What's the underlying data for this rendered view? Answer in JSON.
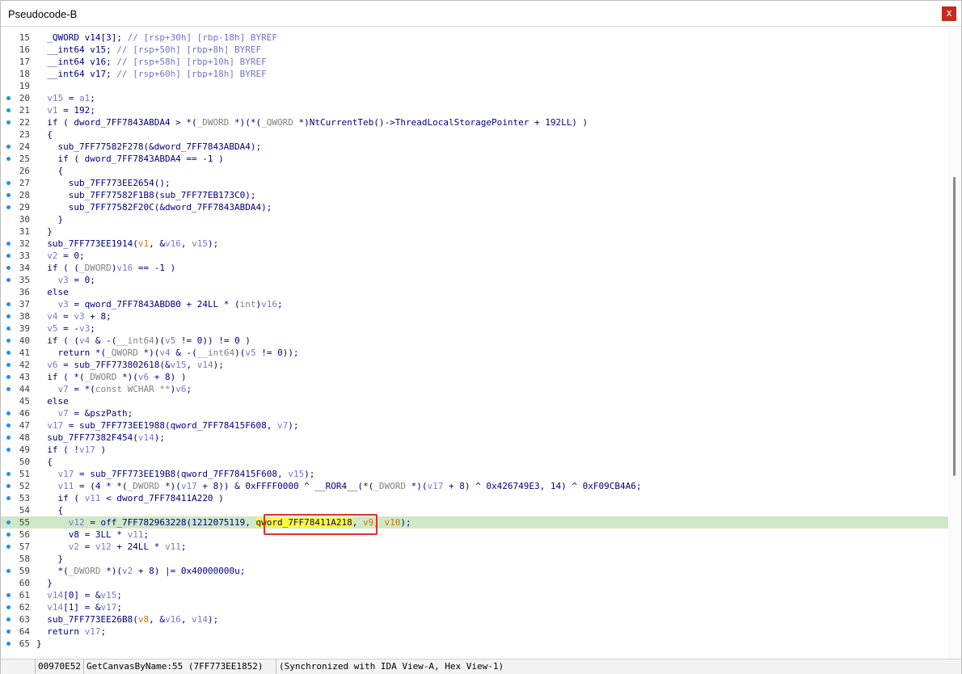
{
  "window": {
    "title": "Pseudocode-B",
    "close_label": "x"
  },
  "code": [
    {
      "n": "15",
      "dot": false,
      "hl": false,
      "tokens": [
        {
          "t": "  _QWORD v14[3]; ",
          "c": "kw"
        },
        {
          "t": "// [rsp+30h] [rbp-18h] BYREF",
          "c": "cm"
        }
      ]
    },
    {
      "n": "16",
      "dot": false,
      "hl": false,
      "tokens": [
        {
          "t": "  __int64 v15; ",
          "c": "kw"
        },
        {
          "t": "// [rsp+50h] [rbp+8h] BYREF",
          "c": "cm"
        }
      ]
    },
    {
      "n": "17",
      "dot": false,
      "hl": false,
      "tokens": [
        {
          "t": "  __int64 v16; ",
          "c": "kw"
        },
        {
          "t": "// [rsp+58h] [rbp+10h] BYREF",
          "c": "cm"
        }
      ]
    },
    {
      "n": "18",
      "dot": false,
      "hl": false,
      "tokens": [
        {
          "t": "  __int64 v17; ",
          "c": "kw"
        },
        {
          "t": "// [rsp+60h] [rbp+18h] BYREF",
          "c": "cm"
        }
      ]
    },
    {
      "n": "19",
      "dot": false,
      "hl": false,
      "tokens": []
    },
    {
      "n": "20",
      "dot": true,
      "hl": false,
      "tokens": [
        {
          "t": "  ",
          "c": "kw"
        },
        {
          "t": "v15",
          "c": "var"
        },
        {
          "t": " = ",
          "c": "kw"
        },
        {
          "t": "a1",
          "c": "var"
        },
        {
          "t": ";",
          "c": "kw"
        }
      ]
    },
    {
      "n": "21",
      "dot": true,
      "hl": false,
      "tokens": [
        {
          "t": "  ",
          "c": "kw"
        },
        {
          "t": "v1",
          "c": "var"
        },
        {
          "t": " = 192;",
          "c": "kw"
        }
      ]
    },
    {
      "n": "22",
      "dot": true,
      "hl": false,
      "tokens": [
        {
          "t": "  if ( dword_7FF7843ABDA4 > *(",
          "c": "kw"
        },
        {
          "t": "_DWORD",
          "c": "ty"
        },
        {
          "t": " *)(*(",
          "c": "kw"
        },
        {
          "t": "_QWORD",
          "c": "ty"
        },
        {
          "t": " *)NtCurrentTeb()->ThreadLocalStoragePointer + 192LL) )",
          "c": "kw"
        }
      ]
    },
    {
      "n": "23",
      "dot": false,
      "hl": false,
      "tokens": [
        {
          "t": "  {",
          "c": "kw"
        }
      ]
    },
    {
      "n": "24",
      "dot": true,
      "hl": false,
      "tokens": [
        {
          "t": "    sub_7FF77582F278(&dword_7FF7843ABDA4);",
          "c": "kw"
        }
      ]
    },
    {
      "n": "25",
      "dot": true,
      "hl": false,
      "tokens": [
        {
          "t": "    if ( dword_7FF7843ABDA4 == -1 )",
          "c": "kw"
        }
      ]
    },
    {
      "n": "26",
      "dot": false,
      "hl": false,
      "tokens": [
        {
          "t": "    {",
          "c": "kw"
        }
      ]
    },
    {
      "n": "27",
      "dot": true,
      "hl": false,
      "tokens": [
        {
          "t": "      sub_7FF773EE2654();",
          "c": "kw"
        }
      ]
    },
    {
      "n": "28",
      "dot": true,
      "hl": false,
      "tokens": [
        {
          "t": "      sub_7FF77582F1B8(sub_7FF77EB173C0);",
          "c": "kw"
        }
      ]
    },
    {
      "n": "29",
      "dot": true,
      "hl": false,
      "tokens": [
        {
          "t": "      sub_7FF77582F20C(&dword_7FF7843ABDA4);",
          "c": "kw"
        }
      ]
    },
    {
      "n": "30",
      "dot": false,
      "hl": false,
      "tokens": [
        {
          "t": "    }",
          "c": "kw"
        }
      ]
    },
    {
      "n": "31",
      "dot": false,
      "hl": false,
      "tokens": [
        {
          "t": "  }",
          "c": "kw"
        }
      ]
    },
    {
      "n": "32",
      "dot": true,
      "hl": false,
      "tokens": [
        {
          "t": "  sub_7FF773EE1914(",
          "c": "kw"
        },
        {
          "t": "v1",
          "c": "arg"
        },
        {
          "t": ", &",
          "c": "kw"
        },
        {
          "t": "v16",
          "c": "var"
        },
        {
          "t": ", ",
          "c": "kw"
        },
        {
          "t": "v15",
          "c": "var"
        },
        {
          "t": ");",
          "c": "kw"
        }
      ]
    },
    {
      "n": "33",
      "dot": true,
      "hl": false,
      "tokens": [
        {
          "t": "  ",
          "c": "kw"
        },
        {
          "t": "v2",
          "c": "var"
        },
        {
          "t": " = 0;",
          "c": "kw"
        }
      ]
    },
    {
      "n": "34",
      "dot": true,
      "hl": false,
      "tokens": [
        {
          "t": "  if ( (",
          "c": "kw"
        },
        {
          "t": "_DWORD",
          "c": "ty"
        },
        {
          "t": ")",
          "c": "kw"
        },
        {
          "t": "v16",
          "c": "var"
        },
        {
          "t": " == -1 )",
          "c": "kw"
        }
      ]
    },
    {
      "n": "35",
      "dot": true,
      "hl": false,
      "tokens": [
        {
          "t": "    ",
          "c": "kw"
        },
        {
          "t": "v3",
          "c": "var"
        },
        {
          "t": " = 0;",
          "c": "kw"
        }
      ]
    },
    {
      "n": "36",
      "dot": false,
      "hl": false,
      "tokens": [
        {
          "t": "  else",
          "c": "kw"
        }
      ]
    },
    {
      "n": "37",
      "dot": true,
      "hl": false,
      "tokens": [
        {
          "t": "    ",
          "c": "kw"
        },
        {
          "t": "v3",
          "c": "var"
        },
        {
          "t": " = qword_7FF7843ABDB0 + 24LL * (",
          "c": "kw"
        },
        {
          "t": "int",
          "c": "ty"
        },
        {
          "t": ")",
          "c": "kw"
        },
        {
          "t": "v16",
          "c": "var"
        },
        {
          "t": ";",
          "c": "kw"
        }
      ]
    },
    {
      "n": "38",
      "dot": true,
      "hl": false,
      "tokens": [
        {
          "t": "  ",
          "c": "kw"
        },
        {
          "t": "v4",
          "c": "var"
        },
        {
          "t": " = ",
          "c": "kw"
        },
        {
          "t": "v3",
          "c": "var"
        },
        {
          "t": " + 8;",
          "c": "kw"
        }
      ]
    },
    {
      "n": "39",
      "dot": true,
      "hl": false,
      "tokens": [
        {
          "t": "  ",
          "c": "kw"
        },
        {
          "t": "v5",
          "c": "var"
        },
        {
          "t": " = -",
          "c": "kw"
        },
        {
          "t": "v3",
          "c": "var"
        },
        {
          "t": ";",
          "c": "kw"
        }
      ]
    },
    {
      "n": "40",
      "dot": true,
      "hl": false,
      "tokens": [
        {
          "t": "  if ( (",
          "c": "kw"
        },
        {
          "t": "v4",
          "c": "var"
        },
        {
          "t": " & -(",
          "c": "kw"
        },
        {
          "t": "__int64",
          "c": "ty"
        },
        {
          "t": ")(",
          "c": "kw"
        },
        {
          "t": "v5",
          "c": "var"
        },
        {
          "t": " != 0)) != 0 )",
          "c": "kw"
        }
      ]
    },
    {
      "n": "41",
      "dot": true,
      "hl": false,
      "tokens": [
        {
          "t": "    return *(",
          "c": "kw"
        },
        {
          "t": "_QWORD",
          "c": "ty"
        },
        {
          "t": " *)(",
          "c": "kw"
        },
        {
          "t": "v4",
          "c": "var"
        },
        {
          "t": " & -(",
          "c": "kw"
        },
        {
          "t": "__int64",
          "c": "ty"
        },
        {
          "t": ")(",
          "c": "kw"
        },
        {
          "t": "v5",
          "c": "var"
        },
        {
          "t": " != 0));",
          "c": "kw"
        }
      ]
    },
    {
      "n": "42",
      "dot": true,
      "hl": false,
      "tokens": [
        {
          "t": "  ",
          "c": "kw"
        },
        {
          "t": "v6",
          "c": "var"
        },
        {
          "t": " = sub_7FF773802618(&",
          "c": "kw"
        },
        {
          "t": "v15",
          "c": "var"
        },
        {
          "t": ", ",
          "c": "kw"
        },
        {
          "t": "v14",
          "c": "var"
        },
        {
          "t": ");",
          "c": "kw"
        }
      ]
    },
    {
      "n": "43",
      "dot": true,
      "hl": false,
      "tokens": [
        {
          "t": "  if ( *(",
          "c": "kw"
        },
        {
          "t": "_DWORD",
          "c": "ty"
        },
        {
          "t": " *)(",
          "c": "kw"
        },
        {
          "t": "v6",
          "c": "var"
        },
        {
          "t": " + 8) )",
          "c": "kw"
        }
      ]
    },
    {
      "n": "44",
      "dot": true,
      "hl": false,
      "tokens": [
        {
          "t": "    ",
          "c": "kw"
        },
        {
          "t": "v7",
          "c": "var"
        },
        {
          "t": " = *(",
          "c": "kw"
        },
        {
          "t": "const WCHAR **",
          "c": "ty"
        },
        {
          "t": ")",
          "c": "kw"
        },
        {
          "t": "v6",
          "c": "var"
        },
        {
          "t": ";",
          "c": "kw"
        }
      ]
    },
    {
      "n": "45",
      "dot": false,
      "hl": false,
      "tokens": [
        {
          "t": "  else",
          "c": "kw"
        }
      ]
    },
    {
      "n": "46",
      "dot": true,
      "hl": false,
      "tokens": [
        {
          "t": "    ",
          "c": "kw"
        },
        {
          "t": "v7",
          "c": "var"
        },
        {
          "t": " = &pszPath;",
          "c": "kw"
        }
      ]
    },
    {
      "n": "47",
      "dot": true,
      "hl": false,
      "tokens": [
        {
          "t": "  ",
          "c": "kw"
        },
        {
          "t": "v17",
          "c": "var"
        },
        {
          "t": " = sub_7FF773EE1988(qword_7FF78415F608, ",
          "c": "kw"
        },
        {
          "t": "v7",
          "c": "var"
        },
        {
          "t": ");",
          "c": "kw"
        }
      ]
    },
    {
      "n": "48",
      "dot": true,
      "hl": false,
      "tokens": [
        {
          "t": "  sub_7FF77382F454(",
          "c": "kw"
        },
        {
          "t": "v14",
          "c": "var"
        },
        {
          "t": ");",
          "c": "kw"
        }
      ]
    },
    {
      "n": "49",
      "dot": true,
      "hl": false,
      "tokens": [
        {
          "t": "  if ( !",
          "c": "kw"
        },
        {
          "t": "v17",
          "c": "var"
        },
        {
          "t": " )",
          "c": "kw"
        }
      ]
    },
    {
      "n": "50",
      "dot": false,
      "hl": false,
      "tokens": [
        {
          "t": "  {",
          "c": "kw"
        }
      ]
    },
    {
      "n": "51",
      "dot": true,
      "hl": false,
      "tokens": [
        {
          "t": "    ",
          "c": "kw"
        },
        {
          "t": "v17",
          "c": "var"
        },
        {
          "t": " = sub_7FF773EE19B8(qword_7FF78415F608, ",
          "c": "kw"
        },
        {
          "t": "v15",
          "c": "var"
        },
        {
          "t": ");",
          "c": "kw"
        }
      ]
    },
    {
      "n": "52",
      "dot": true,
      "hl": false,
      "tokens": [
        {
          "t": "    ",
          "c": "kw"
        },
        {
          "t": "v11",
          "c": "var"
        },
        {
          "t": " = (4 * *(",
          "c": "kw"
        },
        {
          "t": "_DWORD",
          "c": "ty"
        },
        {
          "t": " *)(",
          "c": "kw"
        },
        {
          "t": "v17",
          "c": "var"
        },
        {
          "t": " + 8)) & 0xFFFF0000 ^ __ROR4__(*(",
          "c": "kw"
        },
        {
          "t": "_DWORD",
          "c": "ty"
        },
        {
          "t": " *)(",
          "c": "kw"
        },
        {
          "t": "v17",
          "c": "var"
        },
        {
          "t": " + 8) ^ 0x426749E3, 14) ^ 0xF09CB4A6;",
          "c": "kw"
        }
      ]
    },
    {
      "n": "53",
      "dot": true,
      "hl": false,
      "tokens": [
        {
          "t": "    if ( ",
          "c": "kw"
        },
        {
          "t": "v11",
          "c": "var"
        },
        {
          "t": " < dword_7FF78411A220 )",
          "c": "kw"
        }
      ]
    },
    {
      "n": "54",
      "dot": false,
      "hl": false,
      "tokens": [
        {
          "t": "    {",
          "c": "kw"
        }
      ]
    },
    {
      "n": "55",
      "dot": true,
      "hl": true,
      "tokens": [
        {
          "t": "      ",
          "c": "kw"
        },
        {
          "t": "v12",
          "c": "var"
        },
        {
          "t": " = off_7FF782963228(1212075119, ",
          "c": "kw"
        },
        {
          "t": "qword_7FF78411A218",
          "c": "cur"
        },
        {
          "t": ", ",
          "c": "kw"
        },
        {
          "t": "v9",
          "c": "arg"
        },
        {
          "t": ", ",
          "c": "kw"
        },
        {
          "t": "v10",
          "c": "arg"
        },
        {
          "t": ");",
          "c": "kw"
        }
      ]
    },
    {
      "n": "56",
      "dot": true,
      "hl": false,
      "tokens": [
        {
          "t": "      v8 = 3LL * ",
          "c": "kw"
        },
        {
          "t": "v11",
          "c": "var"
        },
        {
          "t": ";",
          "c": "kw"
        }
      ]
    },
    {
      "n": "57",
      "dot": true,
      "hl": false,
      "tokens": [
        {
          "t": "      ",
          "c": "kw"
        },
        {
          "t": "v2",
          "c": "var"
        },
        {
          "t": " = ",
          "c": "kw"
        },
        {
          "t": "v12",
          "c": "var"
        },
        {
          "t": " + 24LL * ",
          "c": "kw"
        },
        {
          "t": "v11",
          "c": "var"
        },
        {
          "t": ";",
          "c": "kw"
        }
      ]
    },
    {
      "n": "58",
      "dot": false,
      "hl": false,
      "tokens": [
        {
          "t": "    }",
          "c": "kw"
        }
      ]
    },
    {
      "n": "59",
      "dot": true,
      "hl": false,
      "tokens": [
        {
          "t": "    *(",
          "c": "kw"
        },
        {
          "t": "_DWORD",
          "c": "ty"
        },
        {
          "t": " *)(",
          "c": "kw"
        },
        {
          "t": "v2",
          "c": "var"
        },
        {
          "t": " + 8) |= 0x40000000u;",
          "c": "kw"
        }
      ]
    },
    {
      "n": "60",
      "dot": false,
      "hl": false,
      "tokens": [
        {
          "t": "  }",
          "c": "kw"
        }
      ]
    },
    {
      "n": "61",
      "dot": true,
      "hl": false,
      "tokens": [
        {
          "t": "  ",
          "c": "kw"
        },
        {
          "t": "v14",
          "c": "var"
        },
        {
          "t": "[0] = &",
          "c": "kw"
        },
        {
          "t": "v15",
          "c": "var"
        },
        {
          "t": ";",
          "c": "kw"
        }
      ]
    },
    {
      "n": "62",
      "dot": true,
      "hl": false,
      "tokens": [
        {
          "t": "  ",
          "c": "kw"
        },
        {
          "t": "v14",
          "c": "var"
        },
        {
          "t": "[1] = &",
          "c": "kw"
        },
        {
          "t": "v17",
          "c": "var"
        },
        {
          "t": ";",
          "c": "kw"
        }
      ]
    },
    {
      "n": "63",
      "dot": true,
      "hl": false,
      "tokens": [
        {
          "t": "  sub_7FF773EE26B8(",
          "c": "kw"
        },
        {
          "t": "v8",
          "c": "arg"
        },
        {
          "t": ", &",
          "c": "kw"
        },
        {
          "t": "v16",
          "c": "var"
        },
        {
          "t": ", ",
          "c": "kw"
        },
        {
          "t": "v14",
          "c": "var"
        },
        {
          "t": ");",
          "c": "kw"
        }
      ]
    },
    {
      "n": "64",
      "dot": true,
      "hl": false,
      "tokens": [
        {
          "t": "  return ",
          "c": "kw"
        },
        {
          "t": "v17",
          "c": "var"
        },
        {
          "t": ";",
          "c": "kw"
        }
      ]
    },
    {
      "n": "65",
      "dot": true,
      "hl": false,
      "tokens": [
        {
          "t": "}",
          "c": "kw"
        }
      ]
    }
  ],
  "status": {
    "address": "00970E52",
    "location": "GetCanvasByName:55 (7FF773EE1852)",
    "sync": "(Synchronized with IDA View-A, Hex View-1)"
  }
}
